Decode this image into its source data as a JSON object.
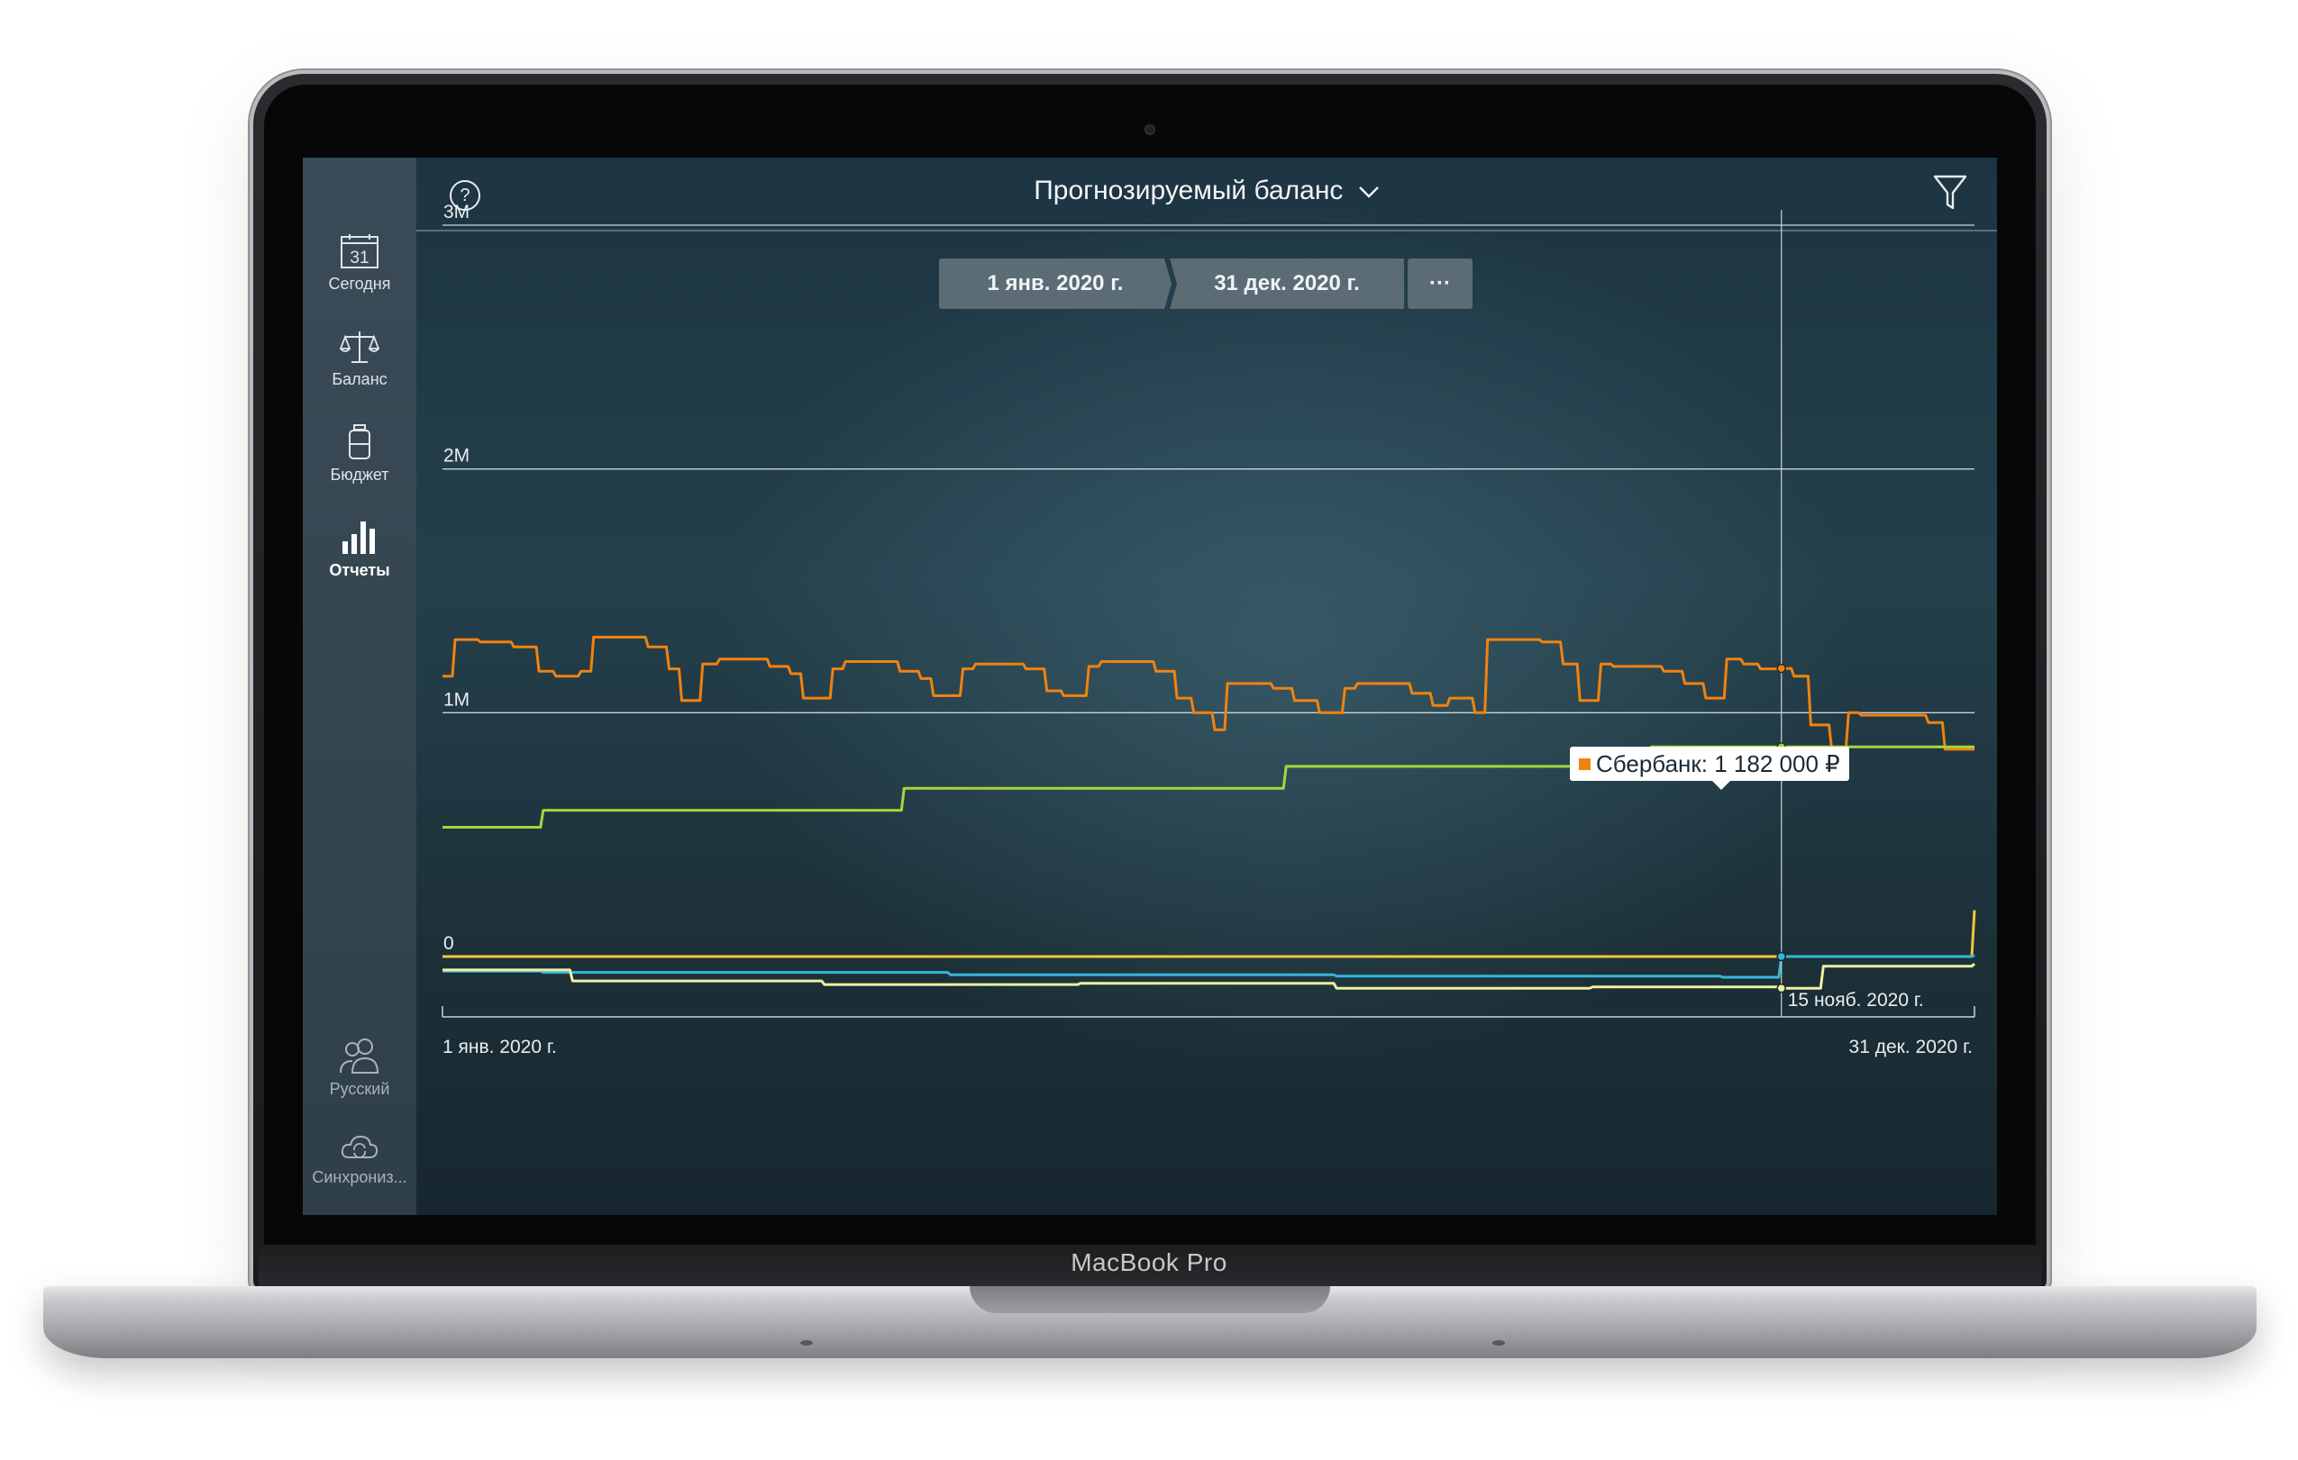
{
  "device": {
    "brand": "MacBook Pro"
  },
  "sidebar": {
    "items": [
      {
        "label": "Сегодня",
        "icon": "calendar-icon",
        "badge": "31"
      },
      {
        "label": "Баланс",
        "icon": "scales-icon"
      },
      {
        "label": "Бюджет",
        "icon": "jar-icon"
      },
      {
        "label": "Отчеты",
        "icon": "bar-chart-icon",
        "active": true
      }
    ],
    "bottom": [
      {
        "label": "Русский",
        "icon": "users-icon"
      },
      {
        "label": "Синхрониз...",
        "icon": "cloud-sync-icon"
      }
    ]
  },
  "header": {
    "title": "Прогнозируемый баланс",
    "help": "?"
  },
  "date_range": {
    "start": "1 янв. 2020 г.",
    "end": "31 дек. 2020 г.",
    "more": "···"
  },
  "tooltip": {
    "series": "Сбербанк",
    "value": "1 182 000 ₽",
    "text": "Сбербанк: 1 182 000 ₽",
    "color": "#f2820f"
  },
  "chart_data": {
    "type": "line",
    "y_ticks": [
      "3M",
      "2M",
      "1M",
      "0"
    ],
    "y_tick_values": [
      3000000,
      2000000,
      1000000,
      0
    ],
    "ylim": [
      -290000,
      3000000
    ],
    "xlim": [
      "2020-01-01",
      "2020-12-31"
    ],
    "x_tick_labels": [
      "1 янв. 2020 г.",
      "31 дек. 2020 г."
    ],
    "cursor": {
      "date": "2020-11-15",
      "label": "15 нояб. 2020 г."
    },
    "grid": true,
    "series": [
      {
        "name": "Сбербанк",
        "color": "#f2820f",
        "x": [
          "2020-01-01",
          "2020-01-04",
          "2020-01-10",
          "2020-01-18",
          "2020-01-24",
          "2020-01-28",
          "2020-02-03",
          "2020-02-06",
          "2020-02-19",
          "2020-02-24",
          "2020-02-27",
          "2020-03-03",
          "2020-03-07",
          "2020-03-19",
          "2020-03-24",
          "2020-03-27",
          "2020-04-03",
          "2020-04-06",
          "2020-04-19",
          "2020-04-24",
          "2020-04-27",
          "2020-05-04",
          "2020-05-07",
          "2020-05-19",
          "2020-05-24",
          "2020-05-28",
          "2020-06-03",
          "2020-06-06",
          "2020-06-19",
          "2020-06-24",
          "2020-06-28",
          "2020-07-03",
          "2020-07-06",
          "2020-07-17",
          "2020-07-22",
          "2020-07-28",
          "2020-08-03",
          "2020-08-06",
          "2020-08-19",
          "2020-08-24",
          "2020-08-28",
          "2020-09-03",
          "2020-09-06",
          "2020-09-19",
          "2020-09-24",
          "2020-09-28",
          "2020-10-03",
          "2020-10-06",
          "2020-10-18",
          "2020-10-23",
          "2020-10-28",
          "2020-11-02",
          "2020-11-06",
          "2020-11-10",
          "2020-11-15",
          "2020-11-18",
          "2020-11-22",
          "2020-11-27",
          "2020-12-01",
          "2020-12-04",
          "2020-12-10",
          "2020-12-20",
          "2020-12-24",
          "2020-12-31"
        ],
        "y": [
          1150000,
          1300000,
          1290000,
          1270000,
          1170000,
          1150000,
          1170000,
          1310000,
          1270000,
          1180000,
          1050000,
          1200000,
          1220000,
          1190000,
          1160000,
          1060000,
          1180000,
          1210000,
          1170000,
          1140000,
          1070000,
          1180000,
          1200000,
          1180000,
          1090000,
          1070000,
          1190000,
          1210000,
          1170000,
          1060000,
          1000000,
          930000,
          1120000,
          1100000,
          1050000,
          1000000,
          1100000,
          1120000,
          1080000,
          1030000,
          1060000,
          1000000,
          1300000,
          1290000,
          1200000,
          1050000,
          1200000,
          1190000,
          1170000,
          1120000,
          1060000,
          1220000,
          1200000,
          1180000,
          1182000,
          1150000,
          950000,
          850000,
          1000000,
          990000,
          990000,
          960000,
          850000,
          850000
        ]
      },
      {
        "name": "",
        "color": "#a6d63d",
        "x": [
          "2020-01-01",
          "2020-01-25",
          "2020-04-20",
          "2020-07-20",
          "2020-10-15",
          "2020-12-31"
        ],
        "y": [
          530000,
          600000,
          690000,
          780000,
          860000,
          860000
        ]
      },
      {
        "name": "",
        "color": "#f3c73a",
        "x": [
          "2020-01-01",
          "2020-11-25",
          "2020-12-31"
        ],
        "y": [
          0,
          0,
          190000
        ],
        "note": "step up at end"
      },
      {
        "name": "",
        "color": "#36b6d9",
        "x": [
          "2020-01-01",
          "2020-01-25",
          "2020-05-01",
          "2020-08-01",
          "2020-11-01",
          "2020-11-15",
          "2020-12-31"
        ],
        "y": [
          -60000,
          -65000,
          -75000,
          -80000,
          -85000,
          0,
          5000
        ]
      },
      {
        "name": "",
        "color": "#eef0a0",
        "x": [
          "2020-01-01",
          "2020-02-01",
          "2020-04-01",
          "2020-06-01",
          "2020-08-01",
          "2020-10-01",
          "2020-11-15",
          "2020-11-25",
          "2020-12-31"
        ],
        "y": [
          -55000,
          -100000,
          -115000,
          -110000,
          -130000,
          -125000,
          -130000,
          -40000,
          -30000
        ]
      }
    ]
  }
}
